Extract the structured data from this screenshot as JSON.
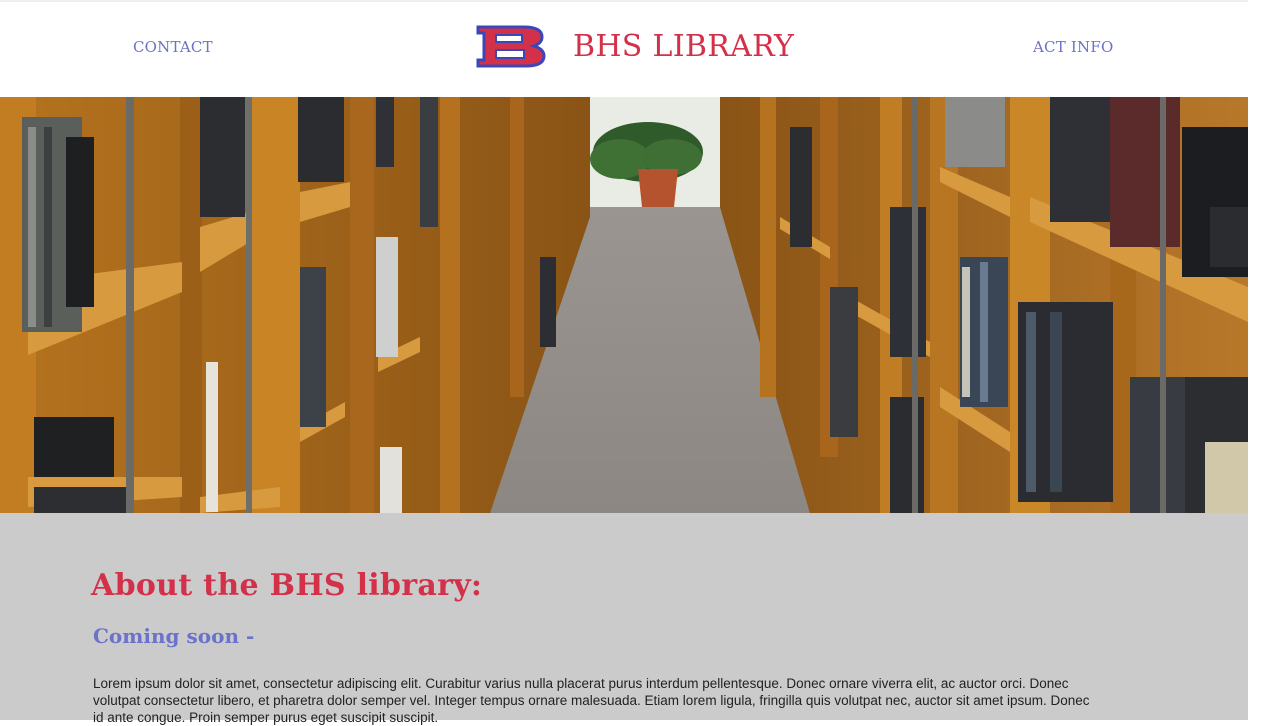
{
  "header": {
    "nav_left": "CONTACT",
    "nav_right": "ACT INFO",
    "brand_title": "BHS LIBRARY",
    "logo_letter": "B"
  },
  "hero": {
    "image_description": "library-aisle-photo"
  },
  "about": {
    "title": "About the BHS library:",
    "subtitle": "Coming soon -",
    "body": "Lorem ipsum dolor sit amet, consectetur adipiscing elit. Curabitur varius nulla placerat purus interdum pellentesque. Donec ornare viverra elit, ac auctor orci. Donec volutpat consectetur libero, et pharetra dolor semper vel. Integer tempus ornare malesuada. Etiam lorem ligula, fringilla quis volutpat nec, auctor sit amet ipsum. Donec id ante congue. Proin semper purus eget suscipit suscipit."
  },
  "colors": {
    "brand_red": "#d3304a",
    "nav_blue": "#6b72c9",
    "about_bg": "#cbcbcb"
  }
}
